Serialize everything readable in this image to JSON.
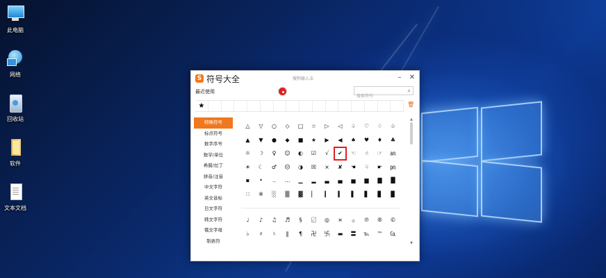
{
  "desktop": {
    "icons": [
      {
        "label": "此电脑",
        "icon": "computer-icon"
      },
      {
        "label": "网络",
        "icon": "network-icon"
      },
      {
        "label": "回收站",
        "icon": "recycle-bin-icon"
      },
      {
        "label": "软件",
        "icon": "folder-icon"
      },
      {
        "label": "文本文档",
        "icon": "text-document-icon"
      }
    ]
  },
  "window": {
    "title": "符号大全",
    "center_title": "搜狗输入法",
    "logo": "S",
    "minimize": "–",
    "close": "✕",
    "recent_label": "最近使用",
    "search_placeholder": "搜索符号",
    "search_icon": "⌕",
    "trash_icon": "🗑",
    "recent": [
      "★",
      "",
      "",
      "",
      "",
      "",
      "",
      "",
      "",
      "",
      "",
      "",
      "",
      "",
      "",
      ""
    ],
    "categories": [
      {
        "label": "特殊符号",
        "active": true
      },
      {
        "label": "标点符号",
        "active": false
      },
      {
        "label": "数字序号",
        "active": false
      },
      {
        "label": "数学/单位",
        "active": false
      },
      {
        "label": "希腊/拉丁",
        "active": false
      },
      {
        "label": "拼音/注音",
        "active": false
      },
      {
        "label": "中文字符",
        "active": false
      },
      {
        "label": "英文音标",
        "active": false
      },
      {
        "label": "日文字符",
        "active": false
      },
      {
        "label": "韩文字符",
        "active": false
      },
      {
        "label": "俄文字母",
        "active": false
      },
      {
        "label": "制表符",
        "active": false
      }
    ],
    "symbols": [
      [
        "△",
        "▽",
        "○",
        "◇",
        "□",
        "☆",
        "▷",
        "◁",
        "♤",
        "♡",
        "♢",
        "♧"
      ],
      [
        "▲",
        "▼",
        "●",
        "◆",
        "■",
        "★",
        "▶",
        "◀",
        "♠",
        "♥",
        "♦",
        "♣"
      ],
      [
        "☼",
        "☽",
        "♀",
        "☺",
        "◐",
        "☑",
        "√",
        "✔",
        "☜",
        "☝",
        "☞",
        "㏂"
      ],
      [
        "☀",
        "☾",
        "♂",
        "☹",
        "◑",
        "☒",
        "×",
        "✘",
        "☚",
        "☟",
        "☛",
        "㏘"
      ],
      [
        "▪",
        "•",
        "‥",
        "…",
        "▁",
        "▂",
        "▃",
        "▄",
        "▅",
        "▆",
        "▇",
        "█"
      ],
      [
        "∷",
        "※",
        "░",
        "▒",
        "▓",
        "▏",
        "▎",
        "▍",
        "▌",
        "▋",
        "▊",
        "▉"
      ]
    ],
    "selected": {
      "row": 2,
      "col": 7
    },
    "symbols2": [
      [
        "♩",
        "♪",
        "♫",
        "♬",
        "§",
        "〼",
        "◎",
        "¤",
        "۞",
        "℗",
        "®",
        "©"
      ],
      [
        "♭",
        "♯",
        "♮",
        "‖",
        "¶",
        "卍",
        "卐",
        "▬",
        "〓",
        "℡",
        "™",
        "㏇"
      ]
    ]
  },
  "colors": {
    "accent": "#f0781e",
    "selection": "#e02020"
  }
}
